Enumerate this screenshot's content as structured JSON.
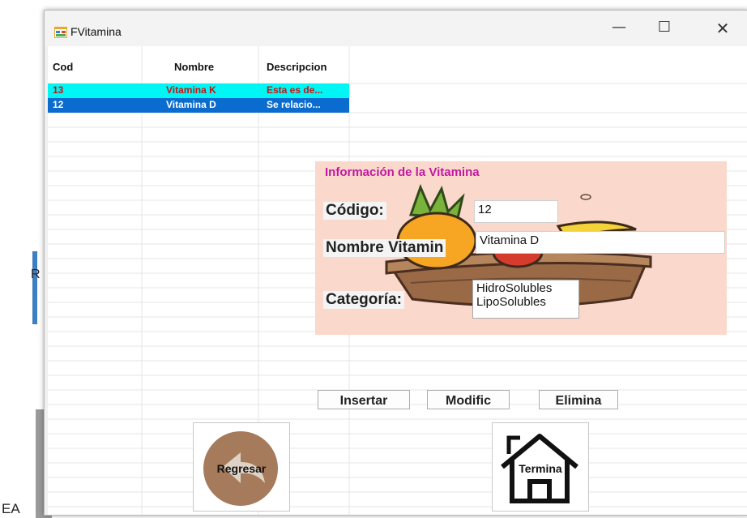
{
  "background": {
    "left_letter": "R",
    "bottom_text": "EA"
  },
  "window": {
    "title": "FVitamina",
    "controls": {
      "minimize": "—",
      "maximize": "☐",
      "close": "✕"
    }
  },
  "table": {
    "headers": [
      "Cod",
      "Nombre",
      "Descripcion"
    ],
    "rows": [
      {
        "cod": "13",
        "nombre": "Vitamina K",
        "descripcion": "Esta es de..."
      },
      {
        "cod": "12",
        "nombre": "Vitamina D",
        "descripcion": "Se relacio..."
      }
    ]
  },
  "info_panel": {
    "title": "Información de la Vitamina",
    "codigo_label": "Código:",
    "codigo_value": "12",
    "nombre_label": "Nombre Vitamin",
    "nombre_value": "Vitamina D",
    "categoria_label": "Categoría:",
    "categoria_options": [
      "HidroSolubles",
      "LipoSolubles"
    ]
  },
  "actions": {
    "insertar": "Insertar",
    "modificar": "Modific",
    "eliminar": "Elimina"
  },
  "nav": {
    "regresar": "Regresar",
    "terminar": "Termina"
  },
  "colors": {
    "row1_bg": "#00f5f5",
    "row2_bg": "#0a6ccf",
    "panel_bg": "#fbd8cc",
    "title_accent": "#c01aa0"
  }
}
